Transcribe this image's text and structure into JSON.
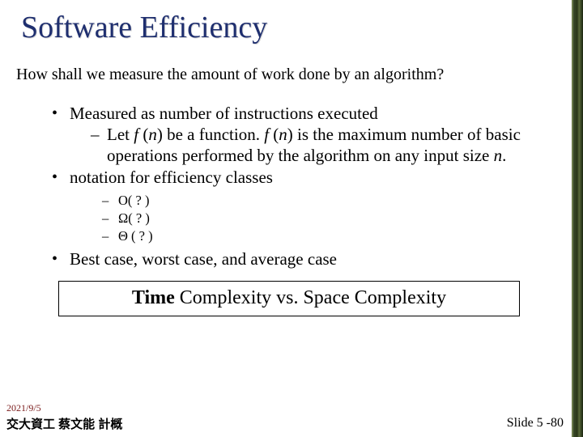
{
  "title": "Software Efficiency",
  "intro": "How shall we measure the amount of work done by an algorithm?",
  "bullets": {
    "b1": "Measured as number of instructions executed",
    "b1a_pre": "Let ",
    "b1a_f": "f ",
    "b1a_mid1": "(",
    "b1a_n1": "n",
    "b1a_mid2": ") be a function. ",
    "b1a_f2": "f ",
    "b1a_mid3": "(",
    "b1a_n2": "n",
    "b1a_mid4": ") is the maximum number of basic operations performed by the algorithm on any input size ",
    "b1a_n3": "n",
    "b1a_end": ".",
    "b2": "notation for efficiency classes",
    "b2a": "O( ? )",
    "b2b": "Ω( ? )",
    "b2c": "Θ ( ? )",
    "b3": "Best case, worst case, and average case"
  },
  "subtitle": {
    "bold1": "Time",
    "mid": " Complexity vs. ",
    "bold2": "",
    "rest": "Space Complexity"
  },
  "footer": {
    "date": "2021/9/5",
    "left": "交大資工 蔡文能 計概",
    "right": "Slide 5 -80"
  }
}
